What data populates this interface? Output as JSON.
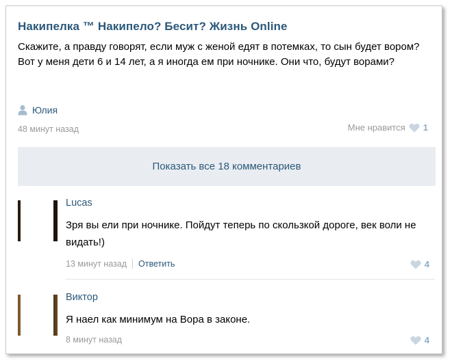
{
  "post": {
    "group_title": "Накипелка ™ Накипело? Бесит? Жизнь Online",
    "text": "Скажите, а правду говорят, если муж с женой едят в потемках, то сын будет вором? Вот у меня дети 6 и 14 лет, а я иногда ем при ночнике. Они что, будут ворами?",
    "author": "Юлия",
    "time": "48 минут назад",
    "like_label": "Мне нравится",
    "like_count": "1"
  },
  "show_all_label": "Показать все 18 комментариев",
  "comments": [
    {
      "name": "Lucas",
      "text": "Зря вы ели при ночнике. Пойдут теперь по скользкой дороге, век воли не видать!)",
      "time": "13 минут назад",
      "reply_label": "Ответить",
      "likes": "4"
    },
    {
      "name": "Виктор",
      "text": "Я наел как минимум на Вора в законе.",
      "time": "8 минут назад",
      "likes": "4"
    }
  ],
  "colors": {
    "link": "#2b587a",
    "muted": "#999999",
    "heart": "#c9d6e2",
    "button_bg": "#e9edf1"
  }
}
